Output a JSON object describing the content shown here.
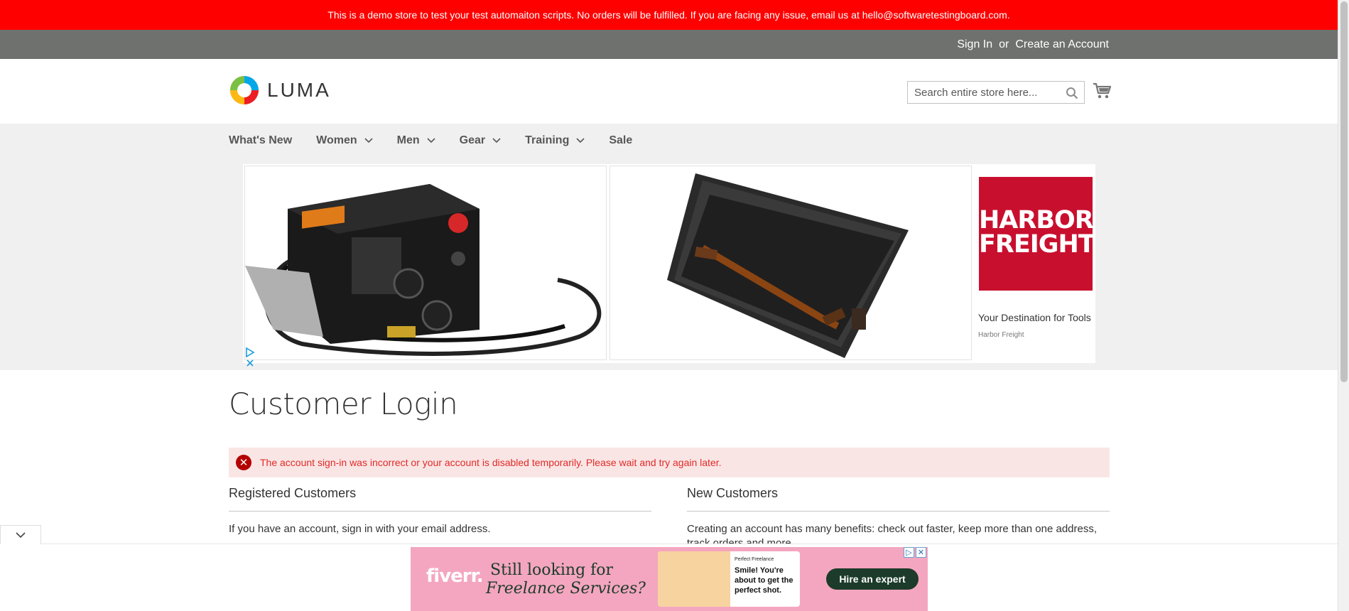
{
  "demo_notice": "This is a demo store to test your test automaiton scripts. No orders will be fulfilled. If you are facing any issue, email us at hello@softwaretestingboard.com.",
  "top_links": {
    "sign_in": "Sign In",
    "or": "or",
    "create_account": "Create an Account"
  },
  "header": {
    "logo_text": "LUMA",
    "search_placeholder": "Search entire store here..."
  },
  "nav": {
    "items": [
      {
        "label": "What's New",
        "has_dropdown": false
      },
      {
        "label": "Women",
        "has_dropdown": true
      },
      {
        "label": "Men",
        "has_dropdown": true
      },
      {
        "label": "Gear",
        "has_dropdown": true
      },
      {
        "label": "Training",
        "has_dropdown": true
      },
      {
        "label": "Sale",
        "has_dropdown": false
      }
    ]
  },
  "ad_banner": {
    "brand_logo": "HARBOR FREIGHT",
    "brand_line1": "HARBOR",
    "brand_line2": "FREIGHT",
    "title": "Your Destination for Tools",
    "advertiser": "Harbor Freight"
  },
  "main": {
    "page_title": "Customer Login",
    "error_message": "The account sign-in was incorrect or your account is disabled temporarily. Please wait and try again later.",
    "registered": {
      "title": "Registered Customers",
      "text": "If you have an account, sign in with your email address."
    },
    "new_customers": {
      "title": "New Customers",
      "text": "Creating an account has many benefits: check out faster, keep more than one address, track orders and more."
    }
  },
  "bottom_ad": {
    "logo": "fiverr.",
    "headline_1": "Still looking for",
    "headline_2": "Freelance Services?",
    "card_small": "Perfect Freelance",
    "card_text": "Smile! You're about to get the perfect shot.",
    "button": "Hire an expert"
  },
  "colors": {
    "demo_bar": "#ff0000",
    "top_bar": "#6e716e",
    "nav_bg": "#f0f0f0",
    "error_bg": "#fae5e5",
    "error_text": "#e02b27",
    "harbor_red": "#c8102e",
    "fiverr_pink": "#f4a6c0"
  }
}
